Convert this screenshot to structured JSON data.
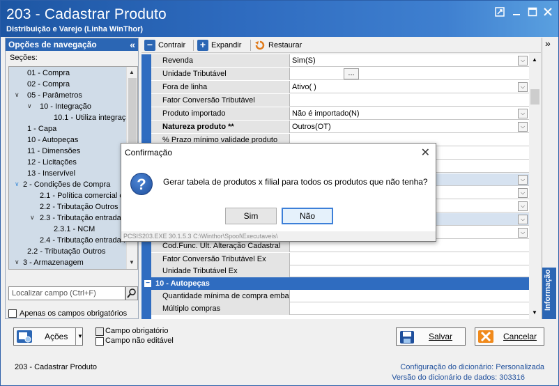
{
  "window": {
    "title": "203 - Cadastrar  Produto",
    "subtitle": "Distribuição e Varejo (Linha WinThor)"
  },
  "nav": {
    "header": "Opções de navegação",
    "sections_label": "Seções:",
    "items": [
      {
        "label": "01 - Compra"
      },
      {
        "label": "02 - Compra"
      },
      {
        "label": "05 - Parâmetros"
      },
      {
        "label": "10 - Integração"
      },
      {
        "label": "10.1 - Utiliza integraçã"
      },
      {
        "label": "1 - Capa"
      },
      {
        "label": "10 - Autopeças"
      },
      {
        "label": "11 - Dimensões"
      },
      {
        "label": "12 - Licitações"
      },
      {
        "label": "13 - Inservível"
      },
      {
        "label": "2 - Condições de Compra"
      },
      {
        "label": "2.1 - Política comercial cor"
      },
      {
        "label": "2.2 - Tributação Outros"
      },
      {
        "label": "2.3 - Tributação entrada"
      },
      {
        "label": "2.3.1 - NCM"
      },
      {
        "label": "2.4 - Tributação entrada I"
      },
      {
        "label": "2.2 - Tributação Outros"
      },
      {
        "label": "3 - Armazenagem"
      }
    ],
    "search_placeholder": "Localizar campo (Ctrl+F)",
    "only_required_label": "Apenas os campos obrigatórios"
  },
  "toolbar": {
    "collapse_label": "Contrair",
    "expand_label": "Expandir",
    "restore_label": "Restaurar"
  },
  "grid": {
    "rows_top": [
      {
        "label": "Revenda",
        "value": "Sim(S)",
        "dropdown": true
      },
      {
        "label": "Unidade Tributável",
        "value": "",
        "ellipsis": "..."
      },
      {
        "label": "Fora de linha",
        "value": "Ativo( )",
        "dropdown": true
      },
      {
        "label": "Fator Conversão Tributável",
        "value": ""
      },
      {
        "label": "Produto importado",
        "value": "Não é importado(N)",
        "dropdown": true
      },
      {
        "label": "Natureza produto **",
        "value": "Outros(OT)",
        "dropdown": true,
        "bold": true
      },
      {
        "label": "% Prazo mínimo validade produto",
        "value": ""
      }
    ],
    "rows_mid": [
      {
        "label": "Cod.Func. Ult. Alteração Cadastral",
        "value": ""
      },
      {
        "label": "Fator Conversão Tributável Ex",
        "value": ""
      },
      {
        "label": "Unidade Tributável Ex",
        "value": ""
      }
    ],
    "section_autopecas": "10 - Autopeças",
    "rows_bottom": [
      {
        "label": "Quantidade mínima de compra embala",
        "value": ""
      },
      {
        "label": "Múltiplo compras",
        "value": ""
      }
    ]
  },
  "info_panel": {
    "label": "Informação"
  },
  "footer": {
    "actions_label": "Ações",
    "required_field_label": "Campo obrigatório",
    "non_editable_label": "Campo não editável",
    "save_label": "Salvar",
    "cancel_label": "Cancelar"
  },
  "status": {
    "routine": "203 - Cadastrar  Produto",
    "dict_config_label": "Configuração do dicionário:",
    "dict_config_value": "Personalizada",
    "dict_version_label": "Versão do dicionário de dados:",
    "dict_version_value": "303316"
  },
  "dialog": {
    "title": "Confirmação",
    "message": "Gerar tabela de produtos x filial para todos os produtos que não tenha?",
    "yes_label": "Sim",
    "no_label": "Não",
    "footer": "PCSIS203.EXE 30.1.5.3 C:\\Winthor\\Spool\\Executaveis\\"
  },
  "colors": {
    "title_blue": "#1d56a3",
    "section_blue": "#2f6cc0",
    "link_blue": "#1f4f9c"
  }
}
